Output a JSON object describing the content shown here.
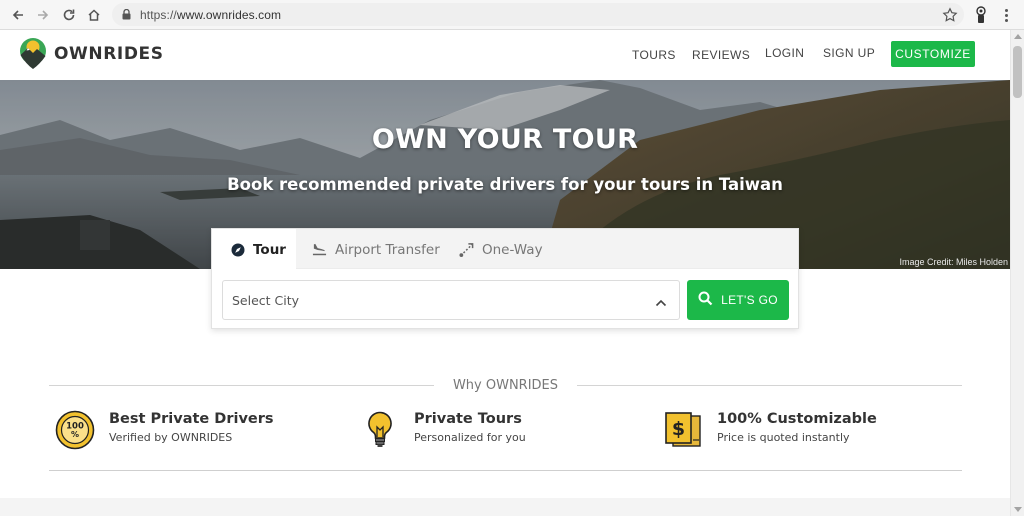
{
  "browser": {
    "url_scheme": "https://",
    "url_host": "www.ownrides.com"
  },
  "header": {
    "brand": "OWNRIDES",
    "nav": {
      "tours": "TOURS",
      "reviews": "REVIEWS",
      "login": "LOGIN",
      "signup": "SIGN UP",
      "customize": "CUSTOMIZE"
    }
  },
  "hero": {
    "title": "OWN YOUR TOUR",
    "subtitle": "Book recommended private drivers for your tours in Taiwan",
    "credit": "Image Credit: Miles Holden"
  },
  "search": {
    "tabs": [
      {
        "label": "Tour",
        "icon": "compass-icon",
        "active": true
      },
      {
        "label": "Airport Transfer",
        "icon": "plane-landing-icon",
        "active": false
      },
      {
        "label": "One-Way",
        "icon": "route-icon",
        "active": false
      }
    ],
    "select_placeholder": "Select City",
    "go_label": "LET'S GO"
  },
  "why": {
    "title": "Why OWNRIDES",
    "features": [
      {
        "title": "Best Private Drivers",
        "subtitle": "Verified by OWNRIDES",
        "icon": "100-percent-badge-icon"
      },
      {
        "title": "Private Tours",
        "subtitle": "Personalized for you",
        "icon": "lightbulb-icon"
      },
      {
        "title": "100% Customizable",
        "subtitle": "Price is quoted instantly",
        "icon": "price-tag-icon"
      }
    ]
  },
  "colors": {
    "accent_green": "#1cb849",
    "logo_yellow": "#f2c12e",
    "logo_green": "#3aa655"
  }
}
